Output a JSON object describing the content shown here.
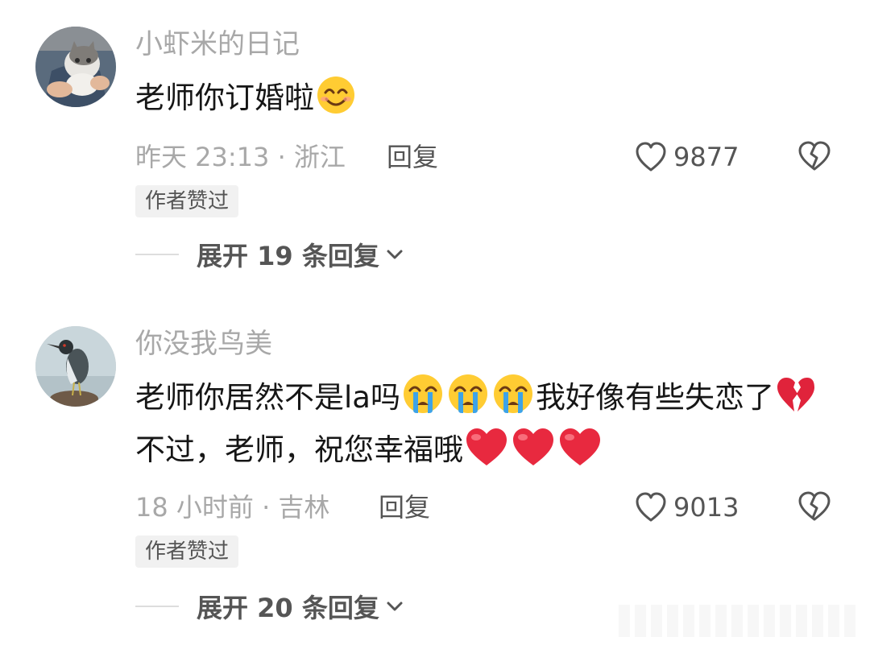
{
  "comments": [
    {
      "username": "小虾米的日记",
      "text_parts": [
        "老师你订婚啦"
      ],
      "time": "昨天 23:13 · 浙江",
      "reply_label": "回复",
      "likes": "9877",
      "badge": "作者赞过",
      "expand_label": "展开 19 条回复",
      "avatar": "cat-avatar"
    },
    {
      "username": "你没我鸟美",
      "text_parts": [
        "老师你居然不是la吗",
        "我好像有些失恋了",
        "不过，老师，祝您幸福哦"
      ],
      "time": "18 小时前 · 吉林",
      "reply_label": "回复",
      "likes": "9013",
      "badge": "作者赞过",
      "expand_label": "展开 20 条回复",
      "avatar": "heron-avatar"
    }
  ]
}
